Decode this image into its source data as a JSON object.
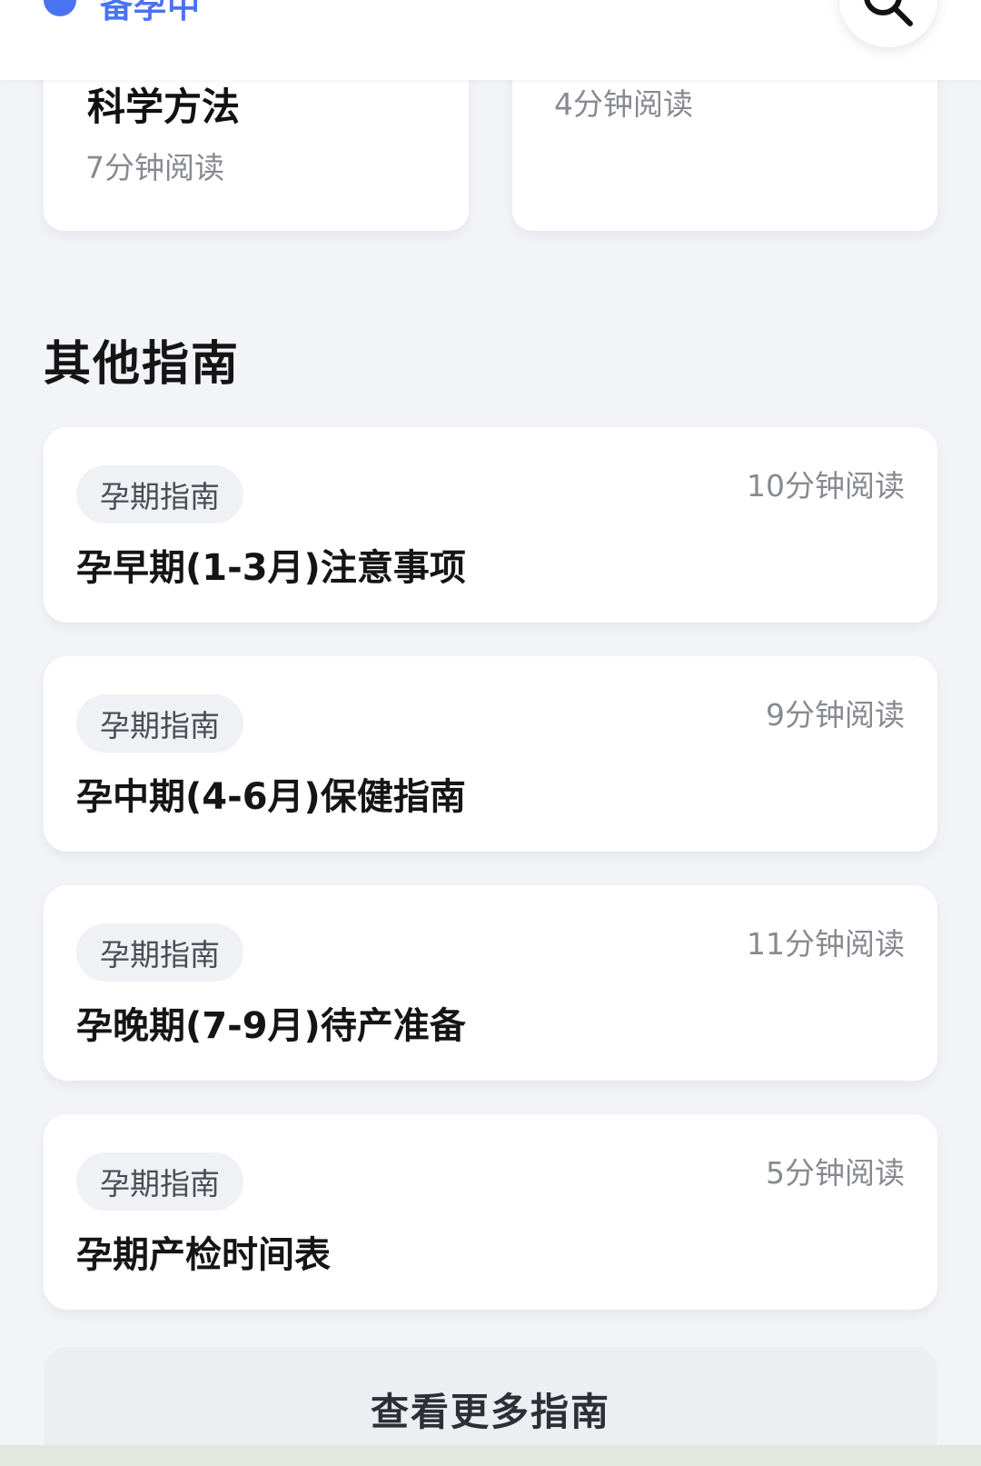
{
  "header": {
    "status_label": "备孕中",
    "search_icon": "search-icon",
    "accent_color": "#4a73f2"
  },
  "top_cards": [
    {
      "title": "科学方法",
      "read_time": "7分钟阅读"
    },
    {
      "title": "",
      "read_time": "4分钟阅读"
    }
  ],
  "section": {
    "title": "其他指南"
  },
  "guides": [
    {
      "tag": "孕期指南",
      "title": "孕早期(1-3月)注意事项",
      "read_time": "10分钟阅读"
    },
    {
      "tag": "孕期指南",
      "title": "孕中期(4-6月)保健指南",
      "read_time": "9分钟阅读"
    },
    {
      "tag": "孕期指南",
      "title": "孕晚期(7-9月)待产准备",
      "read_time": "11分钟阅读"
    },
    {
      "tag": "孕期指南",
      "title": "孕期产检时间表",
      "read_time": "5分钟阅读"
    }
  ],
  "more_button": {
    "label": "查看更多指南"
  }
}
